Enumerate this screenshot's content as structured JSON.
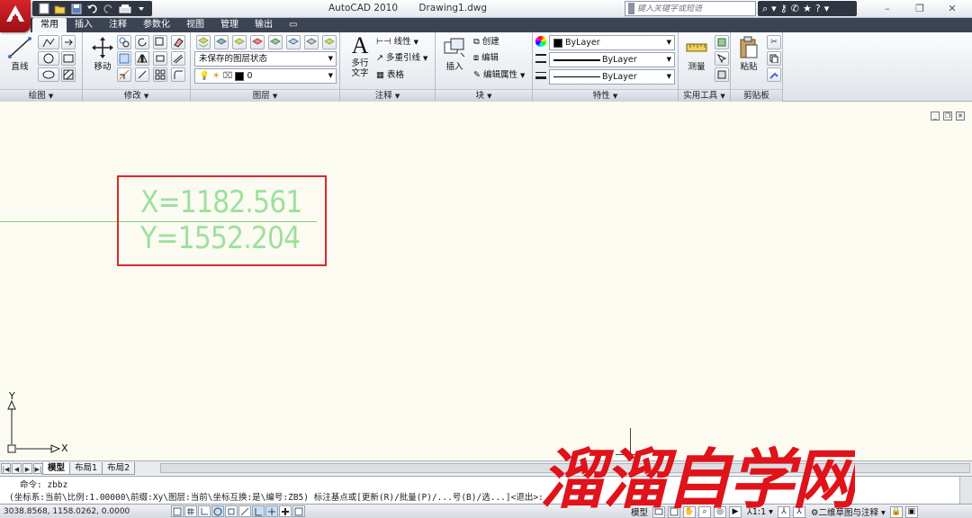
{
  "app": {
    "title": "AutoCAD 2010",
    "document": "Drawing1.dwg",
    "search_placeholder": "键入关键字或短语"
  },
  "ribbon_tabs": [
    "常用",
    "插入",
    "注释",
    "参数化",
    "视图",
    "管理",
    "输出"
  ],
  "panels": {
    "draw": {
      "title": "绘图",
      "line_label": "直线"
    },
    "modify": {
      "title": "修改",
      "move_label": "移动"
    },
    "layers": {
      "title": "图层",
      "layer_state": "未保存的图层状态",
      "current_layer": "0"
    },
    "annotation": {
      "title": "注释",
      "mtext_label_1": "多行",
      "mtext_label_2": "文字",
      "linear": "线性",
      "mleader": "多重引线",
      "table": "表格"
    },
    "block": {
      "title": "块",
      "insert": "插入",
      "create": "创建",
      "edit": "编辑",
      "edit_attr": "编辑属性"
    },
    "properties": {
      "title": "特性",
      "color": "ByLayer",
      "linetype": "ByLayer",
      "lineweight": "ByLayer"
    },
    "utilities": {
      "title": "实用工具",
      "measure": "测量"
    },
    "clipboard": {
      "title": "剪贴板",
      "paste": "粘贴"
    }
  },
  "drawing": {
    "coord_x": "X=1182.561",
    "coord_y": "Y=1552.204",
    "ucs_x": "X",
    "ucs_y": "Y"
  },
  "layout_tabs": [
    "模型",
    "布局1",
    "布局2"
  ],
  "command": {
    "line1": "命令: zbbz",
    "line2": "(坐标系:当前\\比例:1.00000\\前缀:Xy\\图层:当前\\坐标互换:是\\编号:ZB5) 标注基点或[更新(R)/批量(P)/...号(B)/选...]<退出>:"
  },
  "status": {
    "coords": "3038.8568, 1158.0262, 0.0000",
    "model": "模型",
    "scale": "1:1",
    "workspace": "二维草图与注释"
  },
  "watermark": "溜溜自学网",
  "colors": {
    "coord_text": "#9ee09e",
    "highlight_box": "#d82a2a",
    "background": "#fbfbf1",
    "watermark": "#e0121a"
  }
}
